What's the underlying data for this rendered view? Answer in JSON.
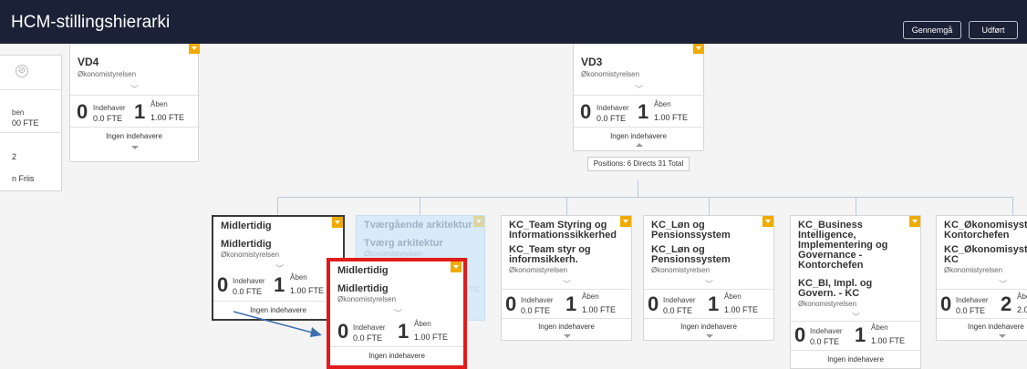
{
  "app": {
    "title": "HCM-stillingshierarki",
    "review_button": "Gennemgå",
    "done_button": "Udført"
  },
  "labels": {
    "indehaver": "Indehaver",
    "aben": "Åben",
    "no_holders": "Ingen indehavere",
    "org": "Økonomistyrelsen"
  },
  "left_partial": {
    "top_label": "VD4",
    "frag_lines": [
      "ben",
      "00 FTE",
      "2",
      "n Friis"
    ]
  },
  "vd4": {
    "top_cut": "VD4",
    "title": "VD4",
    "org": "Økonomistyrelsen",
    "holder_count": "0",
    "holder_fte": "0.0 FTE",
    "open_count": "1",
    "open_fte": "1.00 FTE",
    "footer": "Ingen indehavere"
  },
  "vd3": {
    "top_cut": "VD3",
    "title": "VD3",
    "org": "Økonomistyrelsen",
    "holder_count": "0",
    "holder_fte": "0.0 FTE",
    "open_count": "1",
    "open_fte": "1.00 FTE",
    "footer": "Ingen indehavere",
    "positions": "Positions: 6 Directs 31 Total"
  },
  "children": [
    {
      "title": "Midlertidig",
      "name": "Midlertidig",
      "org": "Økonomistyrelsen",
      "holder_count": "0",
      "holder_fte": "0.0 FTE",
      "open_count": "1",
      "open_fte": "1.00 FTE",
      "footer": "Ingen indehavere"
    },
    {
      "title": "Tværgående arkitektur",
      "name": "Tværg arkitektur",
      "org": "Økonomistyrelsen",
      "open_count": "1",
      "open_fte": "1.00 FTE",
      "footer": "Ingen indehavere"
    },
    {
      "title_lines": [
        "KC_Team Styring og",
        "Informationssikkerhed"
      ],
      "name_lines": [
        "KC_Team styr og",
        "informsikkerh."
      ],
      "org": "Økonomistyrelsen",
      "holder_count": "0",
      "holder_fte": "0.0 FTE",
      "open_count": "1",
      "open_fte": "1.00 FTE",
      "footer": "Ingen indehavere"
    },
    {
      "title_lines": [
        "KC_Løn og",
        "Pensionssystem"
      ],
      "name_lines": [
        "KC_Løn og",
        "Pensionssystem"
      ],
      "org": "Økonomistyrelsen",
      "holder_count": "0",
      "holder_fte": "0.0 FTE",
      "open_count": "1",
      "open_fte": "1.00 FTE",
      "footer": "Ingen indehavere"
    },
    {
      "title_lines": [
        "KC_Business",
        "Intelligence,",
        "Implementering og",
        "Governance -",
        "Kontorchefen"
      ],
      "name_lines": [
        "KC_BI, Impl. og",
        "Govern. - KC"
      ],
      "org": "Økonomistyrelsen",
      "holder_count": "0",
      "holder_fte": "0.0 FTE",
      "open_count": "1",
      "open_fte": "1.00 FTE",
      "footer": "Ingen indehavere"
    },
    {
      "title_lines": [
        "KC_Økonomisystem",
        "Kontorchefen"
      ],
      "name_lines": [
        "KC_Økonomisystem",
        "KC"
      ],
      "org": "Økonomistyrelsen",
      "holder_count": "0",
      "holder_fte": "0.0 FTE",
      "open_count": "2",
      "open_fte": "2.00",
      "footer": "Ingen indehavere"
    }
  ],
  "dragged": {
    "title": "Midlertidig",
    "name": "Midlertidig",
    "org": "Økonomistyrelsen",
    "holder_count": "0",
    "holder_fte": "0.0 FTE",
    "open_count": "1",
    "open_fte": "1.00 FTE",
    "footer": "Ingen indehavere"
  },
  "colors": {
    "topbar": "#1b2136",
    "accent_corner": "#f0ab00",
    "highlight_border": "#e21b1b",
    "arrow": "#3e6fb0",
    "connector": "#b8c9d9",
    "ghost_card": "#d7ebf8"
  },
  "icons": {
    "corner": "chevron-down-icon",
    "expand": "chevron-down-icon",
    "collapse": "triangle-up-icon",
    "blocked": "circle-slash-icon"
  }
}
